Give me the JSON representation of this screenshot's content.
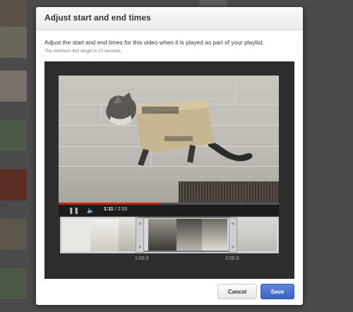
{
  "modal": {
    "title": "Adjust start and end times",
    "description": "Adjust the start and end times for this video when it is played as part of your playlist.",
    "subdescription": "The minimum trim length is 15 seconds."
  },
  "player": {
    "current_time": "1:11",
    "separator": " / ",
    "duration": "2:33",
    "progress_fraction": 0.46,
    "icons": {
      "pause": "pause-icon",
      "volume": "volume-icon"
    }
  },
  "trimmer": {
    "tick_labels": [
      "1:00.0",
      "2:00.0"
    ],
    "start_handle": "«",
    "end_handle": "»"
  },
  "buttons": {
    "cancel": "Cancel",
    "save": "Save"
  },
  "colors": {
    "accent": "#3a63c2",
    "progress": "#d31f1f"
  }
}
